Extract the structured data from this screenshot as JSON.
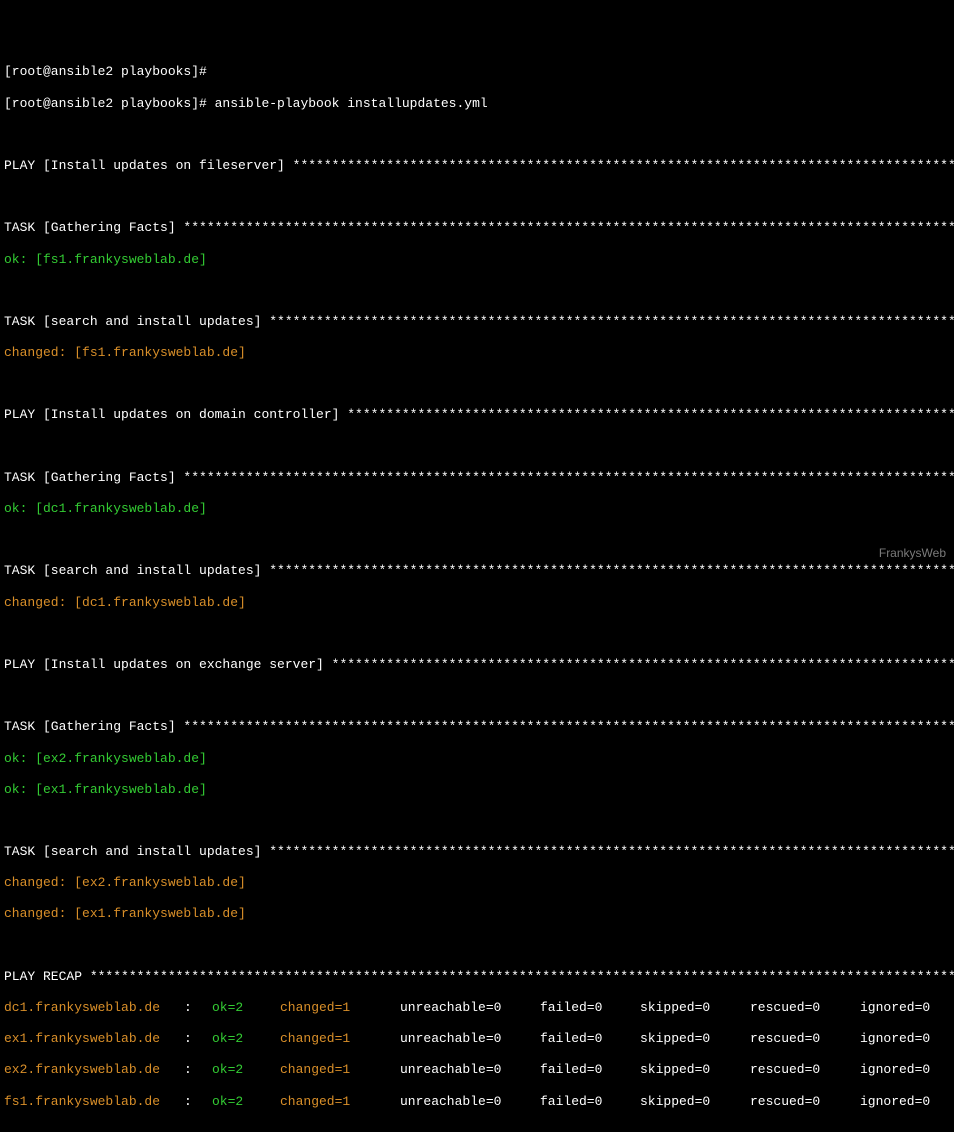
{
  "prompt1": "[root@ansible2 playbooks]#",
  "prompt2": "[root@ansible2 playbooks]# ansible-playbook installupdates.yml",
  "play1": "PLAY [Install updates on fileserver] ****************************************************************************************",
  "task_header": "TASK [Gathering Facts] ******************************************************************************************************",
  "ok_fs1": "ok: [fs1.frankysweblab.de]",
  "task_search": "TASK [search and install updates] *******************************************************************************************",
  "changed_fs1": "changed: [fs1.frankysweblab.de]",
  "play2": "PLAY [Install updates on domain controller] *********************************************************************************",
  "ok_dc1": "ok: [dc1.frankysweblab.de]",
  "changed_dc1": "changed: [dc1.frankysweblab.de]",
  "play3": "PLAY [Install updates on exchange server] ***********************************************************************************",
  "ok_ex2": "ok: [ex2.frankysweblab.de]",
  "ok_ex1": "ok: [ex1.frankysweblab.de]",
  "changed_ex2": "changed: [ex2.frankysweblab.de]",
  "changed_ex1": "changed: [ex1.frankysweblab.de]",
  "recap_header": "PLAY RECAP ******************************************************************************************************************",
  "recap": [
    {
      "host": "dc1.frankysweblab.de",
      "ok": "ok=2",
      "changed": "changed=1",
      "unreachable": "unreachable=0",
      "failed": "failed=0",
      "skipped": "skipped=0",
      "rescued": "rescued=0",
      "ignored": "ignored=0"
    },
    {
      "host": "ex1.frankysweblab.de",
      "ok": "ok=2",
      "changed": "changed=1",
      "unreachable": "unreachable=0",
      "failed": "failed=0",
      "skipped": "skipped=0",
      "rescued": "rescued=0",
      "ignored": "ignored=0"
    },
    {
      "host": "ex2.frankysweblab.de",
      "ok": "ok=2",
      "changed": "changed=1",
      "unreachable": "unreachable=0",
      "failed": "failed=0",
      "skipped": "skipped=0",
      "rescued": "rescued=0",
      "ignored": "ignored=0"
    },
    {
      "host": "fs1.frankysweblab.de",
      "ok": "ok=2",
      "changed": "changed=1",
      "unreachable": "unreachable=0",
      "failed": "failed=0",
      "skipped": "skipped=0",
      "rescued": "rescued=0",
      "ignored": "ignored=0"
    }
  ],
  "sep": ":",
  "watermark": "FrankysWeb"
}
